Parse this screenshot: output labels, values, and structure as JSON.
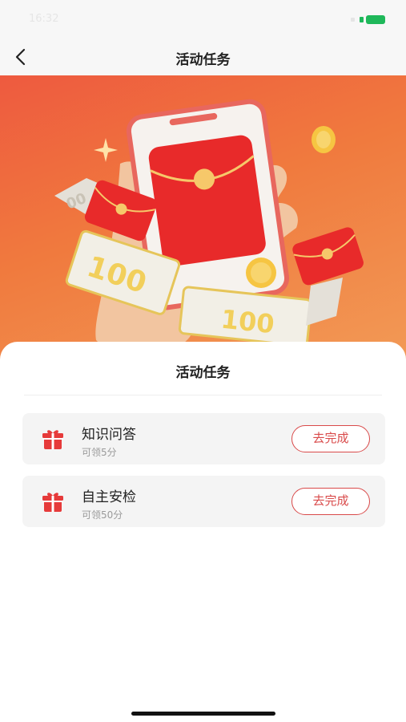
{
  "status_bar": {
    "time": "16:32"
  },
  "nav": {
    "title": "活动任务"
  },
  "banner": {
    "bill_text_left": "100",
    "bill_text_right": "100",
    "bill_text_far": "00"
  },
  "sheet": {
    "title": "活动任务",
    "tasks": [
      {
        "name": "知识问答",
        "reward": "可领5分",
        "button": "去完成"
      },
      {
        "name": "自主安检",
        "reward": "可领50分",
        "button": "去完成"
      }
    ]
  },
  "colors": {
    "accent": "#d94a4a",
    "banner_start": "#ee5a3f",
    "banner_end": "#f29a56",
    "battery": "#1fb85a"
  }
}
